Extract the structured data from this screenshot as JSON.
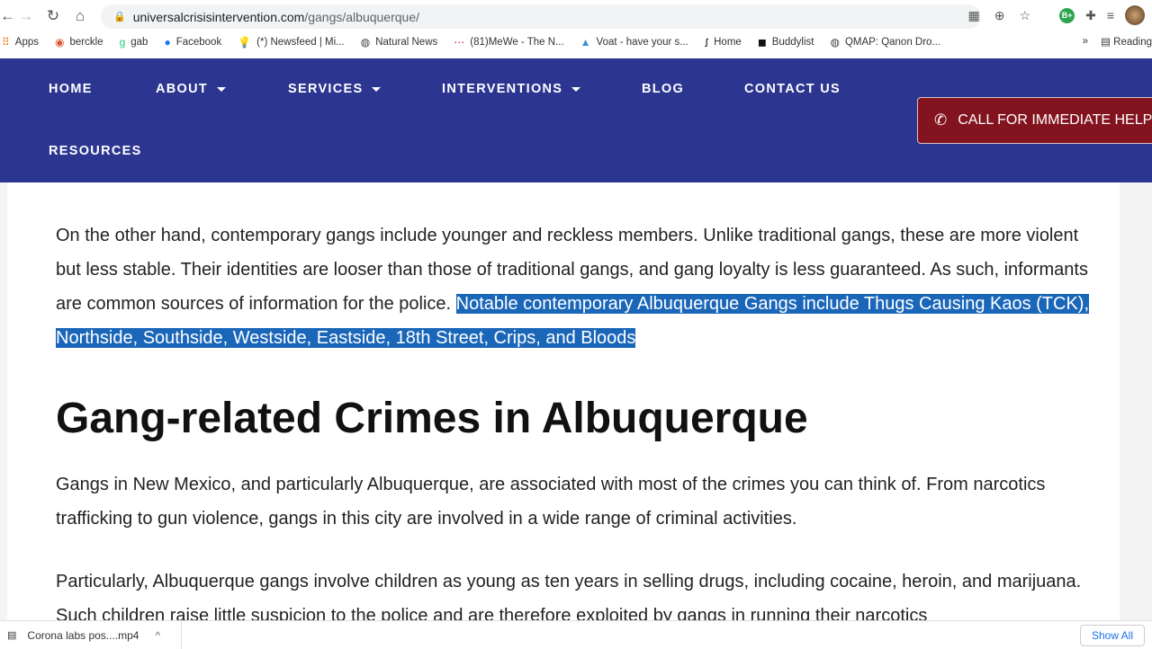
{
  "browser": {
    "url_host": "universalcrisisintervention.com",
    "url_path": "/gangs/albuquerque/",
    "bookmarks": [
      {
        "icon": "apps-grid-icon",
        "label": "Apps"
      },
      {
        "icon": "duckduckgo-icon",
        "label": "berckle"
      },
      {
        "icon": "gab-icon",
        "label": "gab"
      },
      {
        "icon": "facebook-icon",
        "label": "Facebook"
      },
      {
        "icon": "lightbulb-icon",
        "label": "(*) Newsfeed | Mi..."
      },
      {
        "icon": "globe-icon",
        "label": "Natural News"
      },
      {
        "icon": "mewe-icon",
        "label": "(81)MeWe - The N..."
      },
      {
        "icon": "voat-icon",
        "label": "Voat - have your s..."
      },
      {
        "icon": "jh-icon",
        "label": "Home"
      },
      {
        "icon": "buddylist-icon",
        "label": "Buddylist"
      },
      {
        "icon": "globe-icon",
        "label": "QMAP: Qanon Dro..."
      }
    ],
    "more": "»",
    "reading": "Reading",
    "extension_badge": "B+"
  },
  "nav": {
    "items": [
      {
        "label": "HOME",
        "dropdown": false
      },
      {
        "label": "ABOUT",
        "dropdown": true
      },
      {
        "label": "SERVICES",
        "dropdown": true
      },
      {
        "label": "INTERVENTIONS",
        "dropdown": true
      },
      {
        "label": "BLOG",
        "dropdown": false
      },
      {
        "label": "CONTACT US",
        "dropdown": false
      },
      {
        "label": "RESOURCES",
        "dropdown": false
      }
    ],
    "cta": "CALL FOR IMMEDIATE HELP",
    "colors": {
      "nav_bg": "#2c3690",
      "cta_bg": "#83141f",
      "selection": "#1a66b8"
    }
  },
  "article": {
    "p1_plain": "On the other hand, contemporary gangs include younger and reckless members. Unlike traditional gangs, these are more violent but less stable. Their identities are looser than those of traditional gangs, and gang loyalty is less guaranteed. As such, informants are common sources of information for the police. ",
    "p1_highlighted": "Notable contemporary Albuquerque Gangs include Thugs Causing Kaos (TCK), Northside, Southside, Westside, Eastside, 18th Street, Crips, and Bloods",
    "heading": "Gang-related Crimes in Albuquerque",
    "p2": "Gangs in New Mexico, and particularly Albuquerque, are associated with most of the crimes you can think of. From narcotics trafficking to gun violence, gangs in this city are involved in a wide range of criminal activities.",
    "p3": "Particularly, Albuquerque gangs involve children as young as ten years in selling drugs, including cocaine, heroin, and marijuana. Such children raise little suspicion to the police and are therefore exploited by gangs in running their narcotics"
  },
  "downloads": {
    "file": "Corona labs pos....mp4",
    "show_all": "Show All"
  }
}
